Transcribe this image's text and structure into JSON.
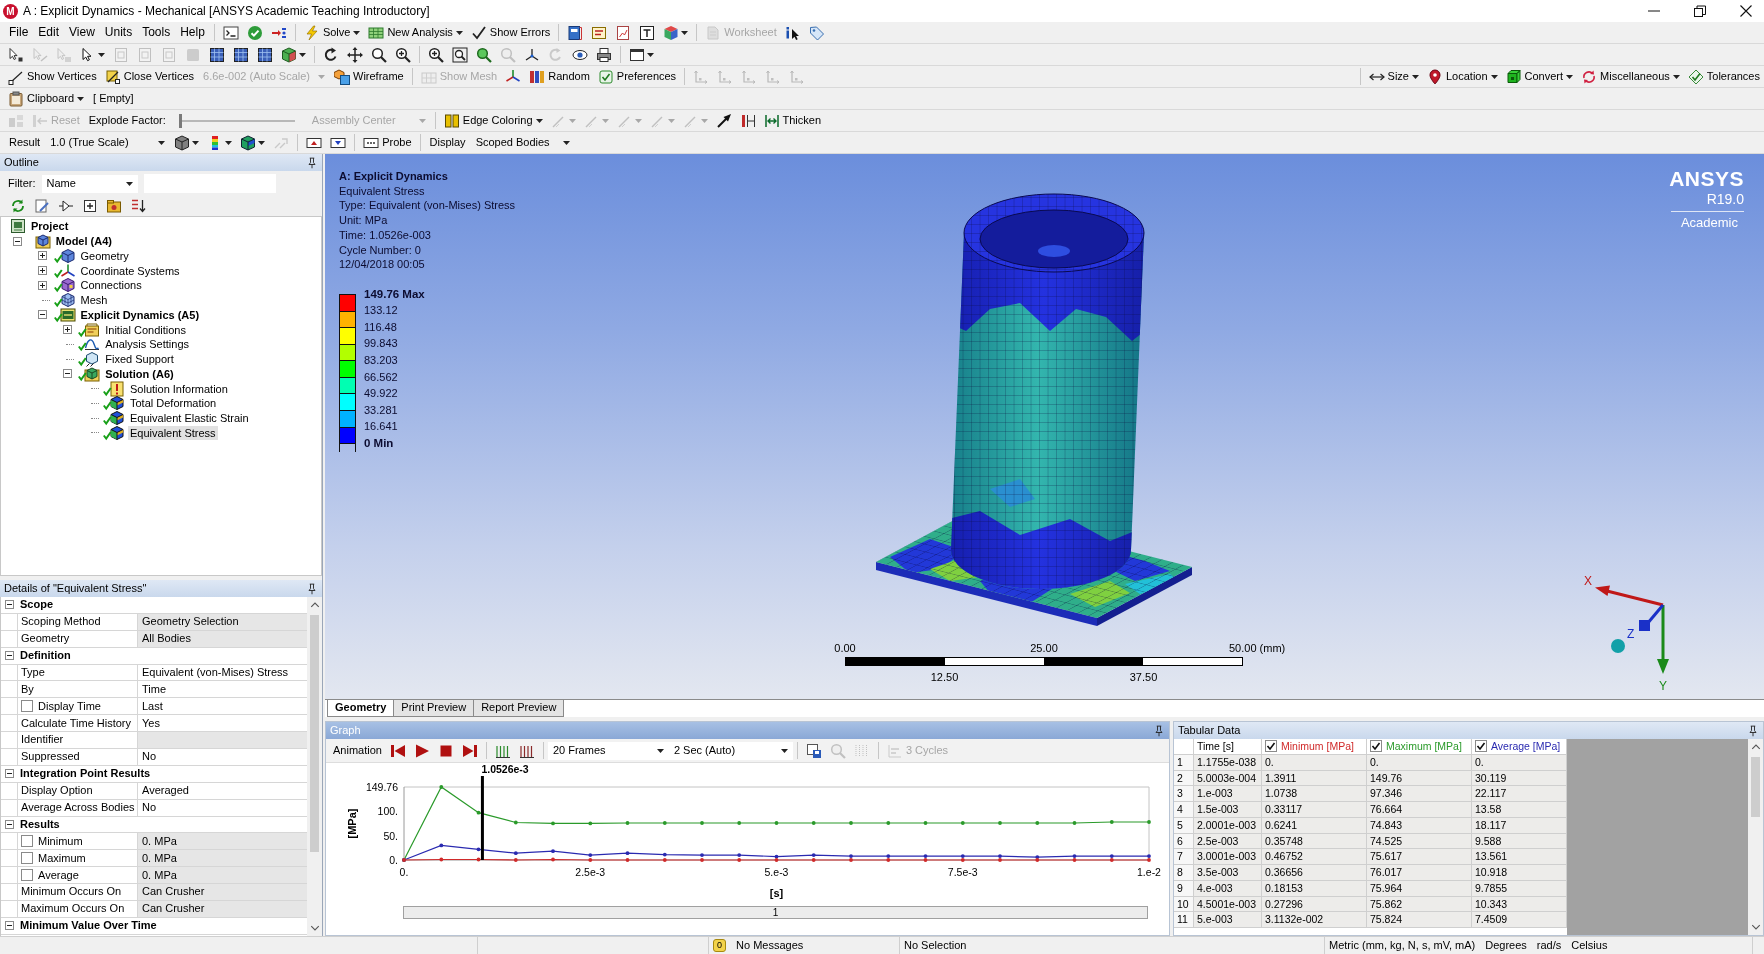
{
  "window": {
    "logo_text": "M",
    "title": "A : Explicit Dynamics - Mechanical [ANSYS Academic Teaching Introductory]"
  },
  "menu": [
    "File",
    "Edit",
    "View",
    "Units",
    "Tools",
    "Help"
  ],
  "standard_toolbar": [
    {
      "label": "Solve",
      "disabled": false
    },
    {
      "label": "New Analysis",
      "disabled": false
    },
    {
      "label": "Show Errors",
      "disabled": false
    },
    {
      "label": "Worksheet",
      "disabled": true
    }
  ],
  "graphics_toolbar": [
    {
      "kind": "button",
      "label": "Show Vertices",
      "disabled": false
    },
    {
      "kind": "button",
      "label": "Close Vertices",
      "disabled": false
    },
    {
      "kind": "combo",
      "value": "6.6e-002 (Auto Scale)",
      "disabled": true
    },
    {
      "kind": "button",
      "label": "Wireframe",
      "disabled": false
    },
    {
      "kind": "button",
      "label": "Show Mesh",
      "disabled": true
    },
    {
      "kind": "button",
      "label": "Random",
      "disabled": false
    },
    {
      "kind": "button",
      "label": "Preferences",
      "disabled": false
    }
  ],
  "mesh_toolbar": [
    {
      "label": "Size"
    },
    {
      "label": "Location"
    },
    {
      "label": "Convert"
    },
    {
      "label": "Miscellaneous"
    },
    {
      "label": "Tolerances"
    }
  ],
  "clipboard_toolbar": {
    "label": "Clipboard",
    "content": "[ Empty]"
  },
  "explode_toolbar": {
    "reset": {
      "label": "Reset",
      "disabled": true
    },
    "factor_label": "Explode Factor:",
    "level": 0,
    "center": {
      "value": "Assembly Center",
      "disabled": true
    }
  },
  "edge_toolbar": [
    {
      "label": "Edge Coloring"
    },
    {
      "label": "Thicken"
    }
  ],
  "result_toolbar": {
    "label": "Result",
    "scale": "1.0 (True Scale)",
    "probe": "Probe",
    "display_label": "Display",
    "display": "Scoped Bodies"
  },
  "outline": {
    "title": "Outline",
    "filter_label": "Filter:",
    "filter_value": "Name",
    "tree": [
      {
        "label": "Project",
        "kind": "heading",
        "done": false,
        "selected": false,
        "children": [
          {
            "label": "Model (A4)",
            "kind": "heading",
            "done": false,
            "selected": false,
            "expanded": true,
            "children": [
              {
                "label": "Geometry",
                "kind": "object",
                "done": true,
                "selected": false,
                "expanded": false
              },
              {
                "label": "Coordinate Systems",
                "kind": "object",
                "done": true,
                "selected": false,
                "expanded": false
              },
              {
                "label": "Connections",
                "kind": "object",
                "done": true,
                "selected": false,
                "expanded": false
              },
              {
                "label": "Mesh",
                "kind": "object",
                "done": true,
                "selected": false
              },
              {
                "label": "Explicit Dynamics (A5)",
                "kind": "heading",
                "done": true,
                "selected": false,
                "expanded": true,
                "children": [
                  {
                    "label": "Initial Conditions",
                    "kind": "object",
                    "done": true,
                    "selected": false,
                    "expanded": false
                  },
                  {
                    "label": "Analysis Settings",
                    "kind": "object",
                    "done": true,
                    "selected": false
                  },
                  {
                    "label": "Fixed Support",
                    "kind": "object",
                    "done": true,
                    "selected": false
                  },
                  {
                    "label": "Solution (A6)",
                    "kind": "heading",
                    "done": true,
                    "selected": false,
                    "expanded": true,
                    "children": [
                      {
                        "label": "Solution Information",
                        "kind": "object",
                        "done": true,
                        "selected": false
                      },
                      {
                        "label": "Total Deformation",
                        "kind": "object",
                        "done": true,
                        "selected": false
                      },
                      {
                        "label": "Equivalent Elastic Strain",
                        "kind": "object",
                        "done": true,
                        "selected": false
                      },
                      {
                        "label": "Equivalent Stress",
                        "kind": "object",
                        "done": true,
                        "selected": true
                      }
                    ]
                  }
                ]
              }
            ]
          }
        ]
      }
    ]
  },
  "details": {
    "title": "Details of \"Equivalent Stress\"",
    "sections": [
      {
        "title": "Scope",
        "expanded": true,
        "rows": [
          {
            "kind": "text",
            "label": "Scoping Method",
            "value": "Geometry Selection",
            "readonly": true
          },
          {
            "kind": "text",
            "label": "Geometry",
            "value": "All Bodies",
            "readonly": true
          }
        ]
      },
      {
        "title": "Definition",
        "expanded": true,
        "rows": [
          {
            "kind": "text",
            "label": "Type",
            "value": "Equivalent (von-Mises) Stress",
            "readonly": false
          },
          {
            "kind": "text",
            "label": "By",
            "value": "Time",
            "readonly": false
          },
          {
            "kind": "checkbox",
            "label": "Display Time",
            "checked": false,
            "value": "Last",
            "readonly": false
          },
          {
            "kind": "text",
            "label": "Calculate Time History",
            "value": "Yes",
            "readonly": false
          },
          {
            "kind": "text",
            "label": "Identifier",
            "readonly": true
          },
          {
            "kind": "text",
            "label": "Suppressed",
            "value": "No",
            "readonly": false
          }
        ]
      },
      {
        "title": "Integration Point Results",
        "expanded": true,
        "rows": [
          {
            "kind": "text",
            "label": "Display Option",
            "value": "Averaged",
            "readonly": false
          },
          {
            "kind": "text",
            "label": "Average Across Bodies",
            "value": "No",
            "readonly": false
          }
        ]
      },
      {
        "title": "Results",
        "expanded": true,
        "rows": [
          {
            "kind": "checkbox",
            "label": "Minimum",
            "checked": false,
            "value": "0. MPa",
            "readonly": true
          },
          {
            "kind": "checkbox",
            "label": "Maximum",
            "checked": false,
            "value": "0. MPa",
            "readonly": true
          },
          {
            "kind": "checkbox",
            "label": "Average",
            "checked": false,
            "value": "0. MPa",
            "readonly": true
          },
          {
            "kind": "text",
            "label": "Minimum Occurs On",
            "value": "Can Crusher",
            "readonly": true
          },
          {
            "kind": "text",
            "label": "Maximum Occurs On",
            "value": "Can Crusher",
            "readonly": true
          }
        ]
      },
      {
        "title": "Minimum Value Over Time",
        "expanded": true
      }
    ]
  },
  "viewport": {
    "info": {
      "title": "A: Explicit Dynamics",
      "lines": [
        "Equivalent Stress",
        "Type: Equivalent (von-Mises) Stress",
        "Unit: MPa",
        "Time: 1.0526e-003",
        "Cycle Number: 0",
        "12/04/2018 00:05"
      ]
    },
    "legend": {
      "labels": [
        "149.76 Max",
        "133.12",
        "116.48",
        "99.843",
        "83.203",
        "66.562",
        "49.922",
        "33.281",
        "16.641",
        "0 Min"
      ],
      "bands": [
        {
          "color": "#ff0000"
        },
        {
          "color": "#ffb200"
        },
        {
          "color": "#ffff00"
        },
        {
          "color": "#b2ff00"
        },
        {
          "color": "#00ff00"
        },
        {
          "color": "#00ffb2"
        },
        {
          "color": "#00ffff"
        },
        {
          "color": "#00b2ff"
        },
        {
          "color": "#0000ff"
        }
      ]
    },
    "logo": {
      "name": "ANSYS",
      "release": "R19.0",
      "edition": "Academic"
    },
    "scale_bar": {
      "top_labels": [
        "0.00",
        "25.00",
        "50.00 (mm)"
      ],
      "bottom_labels": [
        "12.50",
        "37.50"
      ]
    },
    "triad": {
      "x_label": "X",
      "y_label": "Y",
      "z_label": "Z"
    }
  },
  "tabs": [
    {
      "label": "Geometry",
      "selected": true
    },
    {
      "label": "Print Preview",
      "selected": false
    },
    {
      "label": "Report Preview",
      "selected": false
    }
  ],
  "graph": {
    "title": "Graph",
    "animation_label": "Animation",
    "frames": "20 Frames",
    "duration": "2 Sec (Auto)",
    "cycles": {
      "label": "3 Cycles",
      "disabled": true
    },
    "chart_data": [
      {
        "type": "line",
        "xlabel": "[s]",
        "ylabel": "[MPa]",
        "x": [
          0,
          0.0005,
          0.001,
          0.0015,
          0.002,
          0.0025,
          0.003,
          0.0035,
          0.004,
          0.0045,
          0.005,
          0.0055,
          0.006,
          0.0065,
          0.007,
          0.0075,
          0.008,
          0.0085,
          0.009,
          0.0095,
          0.01
        ],
        "xlim": [
          0,
          0.01
        ],
        "ylim": [
          0,
          149.76
        ],
        "xticks": [
          {
            "value": 0,
            "label": "0."
          },
          {
            "value": 0.0025,
            "label": "2.5e-3"
          },
          {
            "value": 0.005,
            "label": "5.e-3"
          },
          {
            "value": 0.0075,
            "label": "7.5e-3"
          },
          {
            "value": 0.01,
            "label": "1.e-2"
          }
        ],
        "yticks": [
          {
            "value": 0,
            "label": "0."
          },
          {
            "value": 50,
            "label": "50."
          },
          {
            "value": 100,
            "label": "100."
          },
          {
            "value": 149.76,
            "label": "149.76"
          }
        ],
        "series": [
          {
            "color": "#2a9a2a",
            "values": [
              0,
              149.76,
              97,
              77,
              75,
              75,
              76,
              76,
              76,
              76,
              76,
              76,
              76,
              76,
              76,
              76,
              76,
              76,
              76,
              78,
              78
            ]
          },
          {
            "color": "#2a2ab0",
            "values": [
              0,
              30,
              22,
              14,
              18,
              10,
              14,
              11,
              10,
              10,
              7,
              10,
              8,
              8,
              8,
              8,
              8,
              6,
              8,
              8,
              8
            ]
          },
          {
            "color": "#d02a2a",
            "values": [
              0,
              1,
              1,
              0,
              1,
              0,
              0,
              0,
              0,
              0,
              0,
              0,
              0,
              0,
              0,
              0,
              0,
              0,
              0,
              0,
              0
            ]
          }
        ],
        "ref_lines": [
          {
            "axis": "x",
            "value": 0.0010526,
            "label": "1.0526e-3",
            "color": "#000000"
          }
        ]
      }
    ],
    "result_set": "1"
  },
  "tabular": {
    "title": "Tabular Data",
    "time_column": "Time [s]",
    "series_columns": [
      {
        "label": "Minimum [MPa]",
        "checked": true,
        "color": "#d02a2a"
      },
      {
        "label": "Maximum [MPa]",
        "checked": true,
        "color": "#2a9a2a"
      },
      {
        "label": "Average [MPa]",
        "checked": true,
        "color": "#2a2ab0"
      }
    ],
    "rows": [
      {
        "index": "1",
        "cells": [
          "1.1755e-038",
          "0.",
          "0.",
          "0."
        ]
      },
      {
        "index": "2",
        "cells": [
          "5.0003e-004",
          "1.3911",
          "149.76",
          "30.119"
        ]
      },
      {
        "index": "3",
        "cells": [
          "1.e-003",
          "1.0738",
          "97.346",
          "22.117"
        ]
      },
      {
        "index": "4",
        "cells": [
          "1.5e-003",
          "0.33117",
          "76.664",
          "13.58"
        ]
      },
      {
        "index": "5",
        "cells": [
          "2.0001e-003",
          "0.6241",
          "74.843",
          "18.117"
        ]
      },
      {
        "index": "6",
        "cells": [
          "2.5e-003",
          "0.35748",
          "74.525",
          "9.588"
        ]
      },
      {
        "index": "7",
        "cells": [
          "3.0001e-003",
          "0.46752",
          "75.617",
          "13.561"
        ]
      },
      {
        "index": "8",
        "cells": [
          "3.5e-003",
          "0.36656",
          "76.017",
          "10.918"
        ]
      },
      {
        "index": "9",
        "cells": [
          "4.e-003",
          "0.18153",
          "75.964",
          "9.7855"
        ]
      },
      {
        "index": "10",
        "cells": [
          "4.5001e-003",
          "0.27296",
          "75.862",
          "10.343"
        ]
      },
      {
        "index": "11",
        "cells": [
          "5.e-003",
          "3.1132e-002",
          "75.824",
          "7.4509"
        ]
      }
    ]
  },
  "status_bar": {
    "messages": {
      "count": "0",
      "label": "No Messages"
    },
    "selection": "No Selection",
    "units": [
      "Metric (mm, kg, N, s, mV, mA)",
      "Degrees",
      "rad/s",
      "Celsius"
    ]
  }
}
